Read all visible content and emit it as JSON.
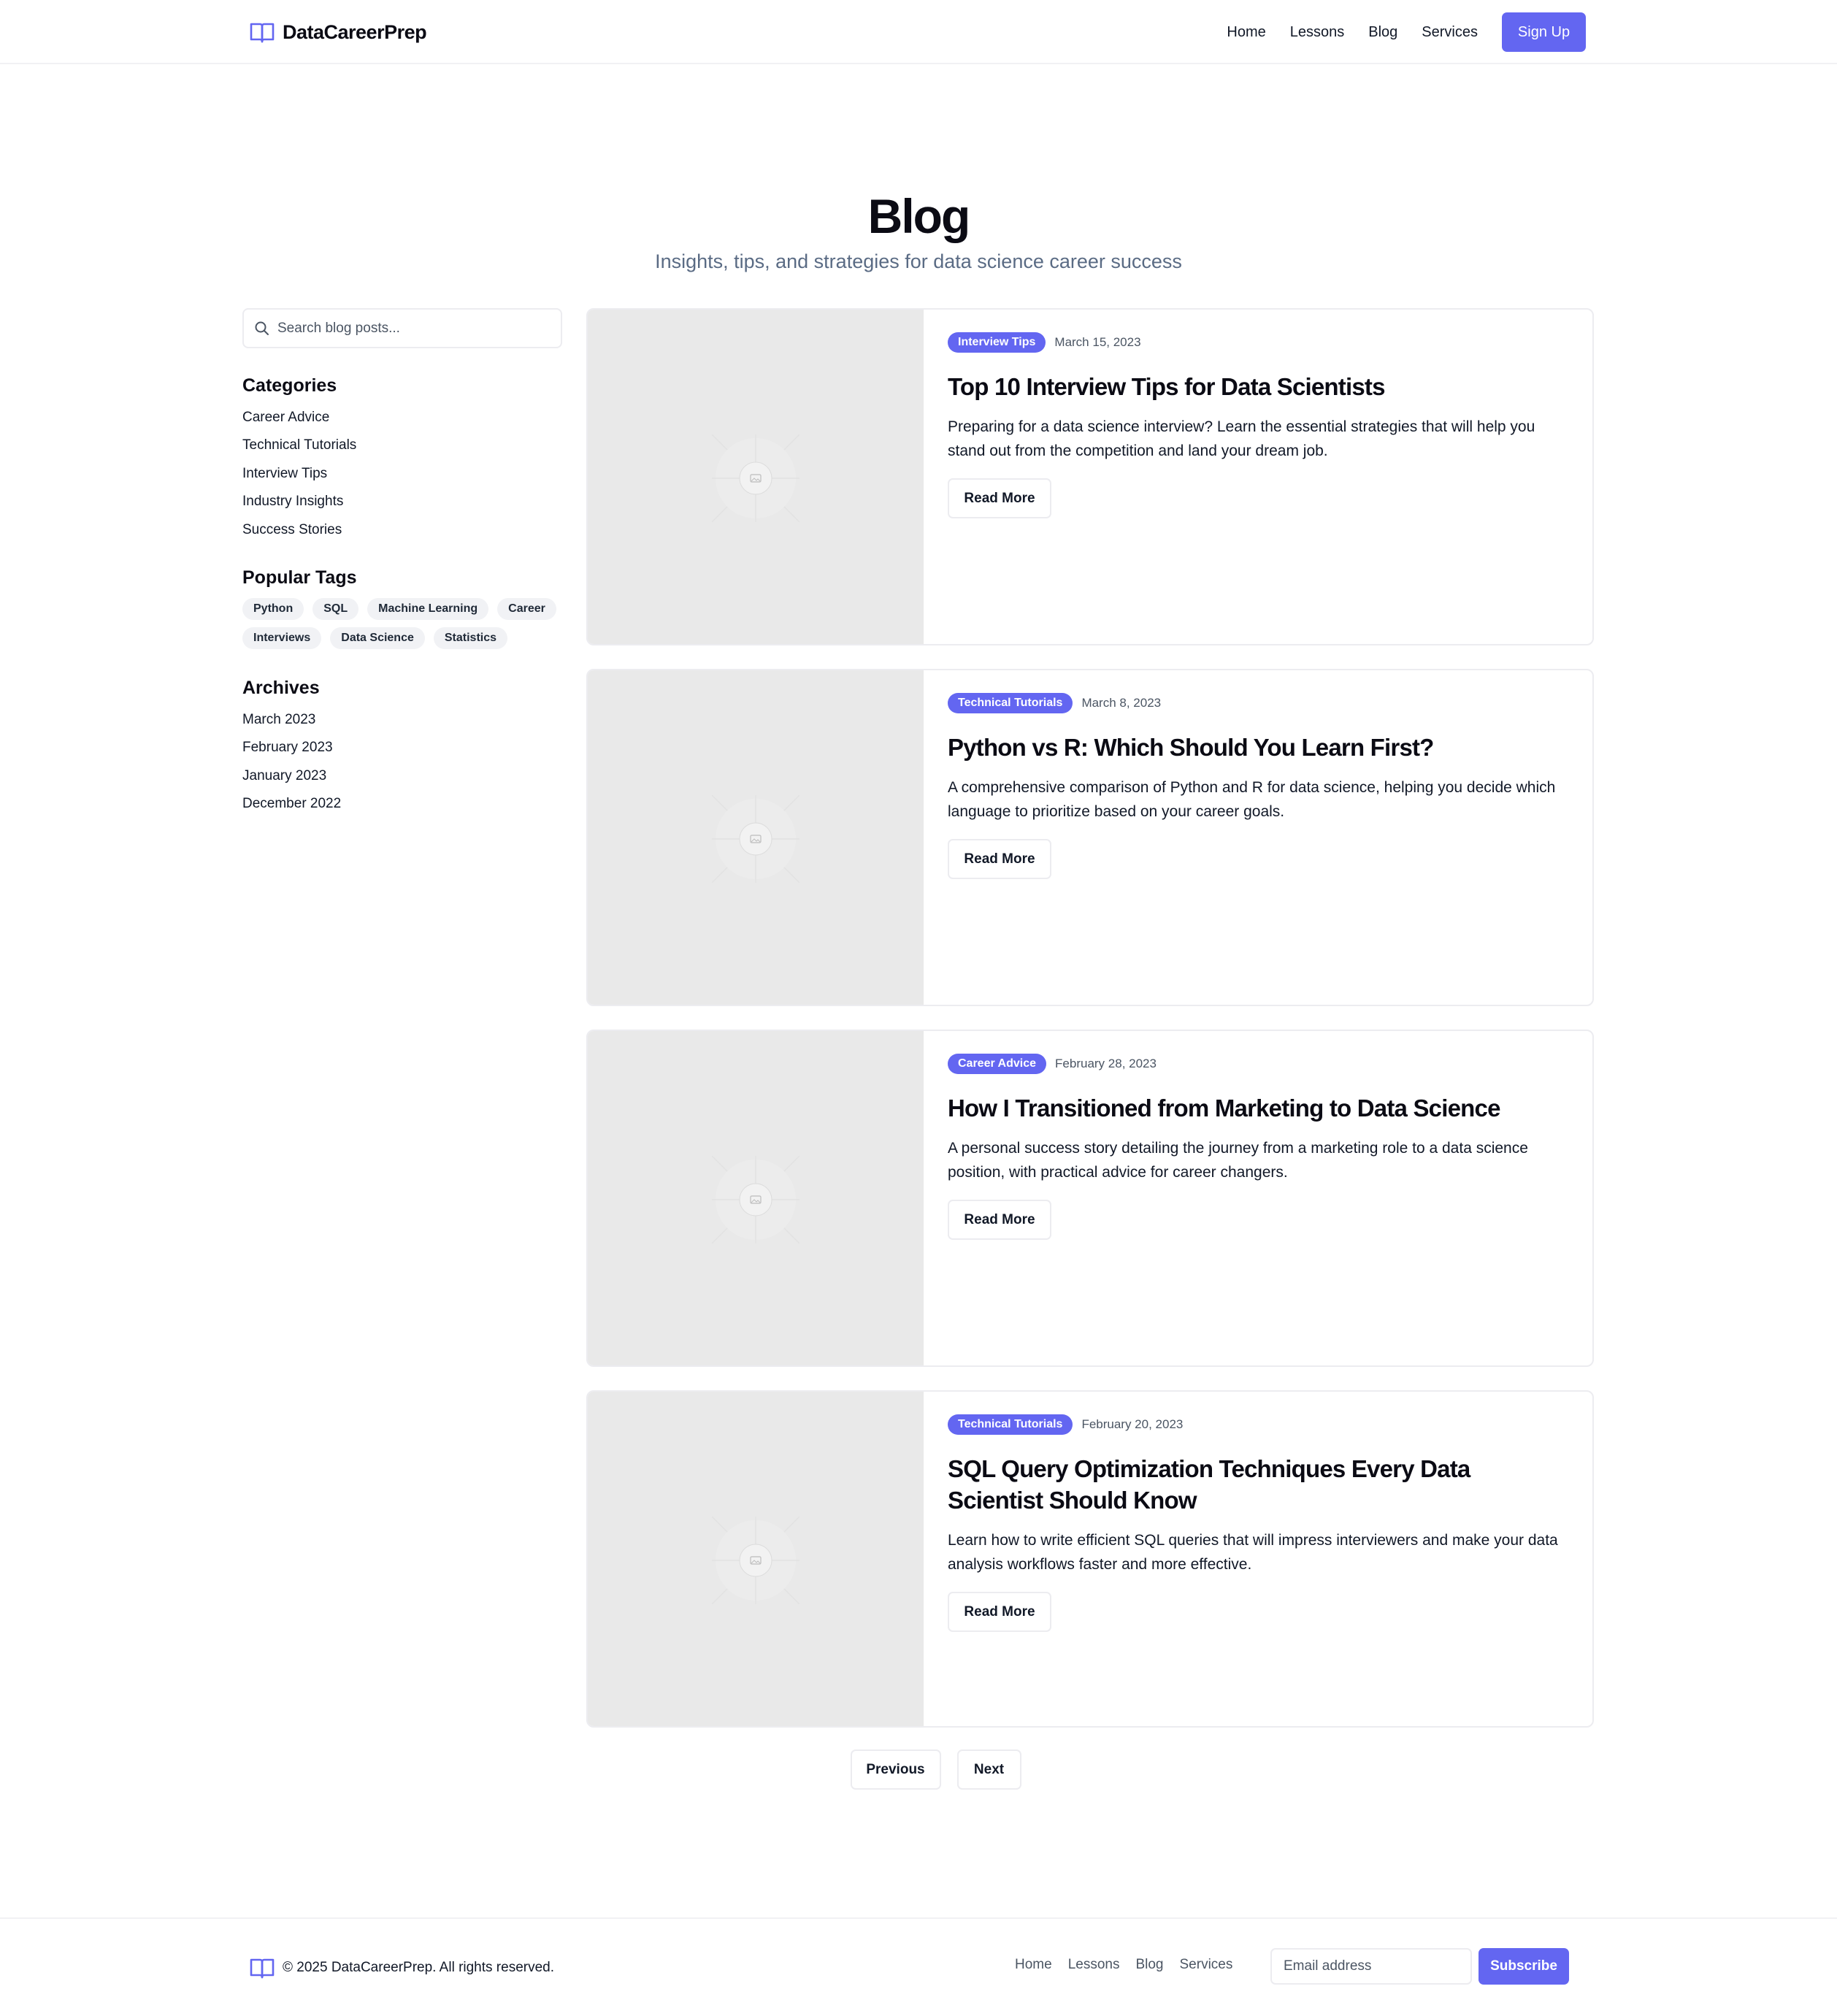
{
  "header": {
    "brand": "DataCareerPrep",
    "nav": [
      "Home",
      "Lessons",
      "Blog",
      "Services"
    ],
    "signup_label": "Sign Up"
  },
  "hero": {
    "title": "Blog",
    "subtitle": "Insights, tips, and strategies for data science career success"
  },
  "sidebar": {
    "search_placeholder": "Search blog posts...",
    "categories_title": "Categories",
    "categories": [
      "Career Advice",
      "Technical Tutorials",
      "Interview Tips",
      "Industry Insights",
      "Success Stories"
    ],
    "tags_title": "Popular Tags",
    "tags": [
      "Python",
      "SQL",
      "Machine Learning",
      "Career",
      "Interviews",
      "Data Science",
      "Statistics"
    ],
    "archives_title": "Archives",
    "archives": [
      "March 2023",
      "February 2023",
      "January 2023",
      "December 2022"
    ]
  },
  "posts": [
    {
      "category": "Interview Tips",
      "date": "March 15, 2023",
      "title": "Top 10 Interview Tips for Data Scientists",
      "excerpt": "Preparing for a data science interview? Learn the essential strategies that will help you stand out from the competition and land your dream job.",
      "read_more": "Read More"
    },
    {
      "category": "Technical Tutorials",
      "date": "March 8, 2023",
      "title": "Python vs R: Which Should You Learn First?",
      "excerpt": "A comprehensive comparison of Python and R for data science, helping you decide which language to prioritize based on your career goals.",
      "read_more": "Read More"
    },
    {
      "category": "Career Advice",
      "date": "February 28, 2023",
      "title": "How I Transitioned from Marketing to Data Science",
      "excerpt": "A personal success story detailing the journey from a marketing role to a data science position, with practical advice for career changers.",
      "read_more": "Read More"
    },
    {
      "category": "Technical Tutorials",
      "date": "February 20, 2023",
      "title": "SQL Query Optimization Techniques Every Data Scientist Should Know",
      "excerpt": "Learn how to write efficient SQL queries that will impress interviewers and make your data analysis workflows faster and more effective.",
      "read_more": "Read More"
    }
  ],
  "pagination": {
    "previous": "Previous",
    "next": "Next"
  },
  "footer": {
    "copyright": "© 2025 DataCareerPrep. All rights reserved.",
    "nav": [
      "Home",
      "Lessons",
      "Blog",
      "Services"
    ],
    "email_placeholder": "Email address",
    "subscribe_label": "Subscribe"
  },
  "colors": {
    "accent": "#6366f1",
    "thumb_bg": "#e9e9e9",
    "border": "#ececf0"
  },
  "icons": {
    "logo": "book-open-icon",
    "search": "search-icon",
    "thumb": "image-placeholder-icon"
  }
}
